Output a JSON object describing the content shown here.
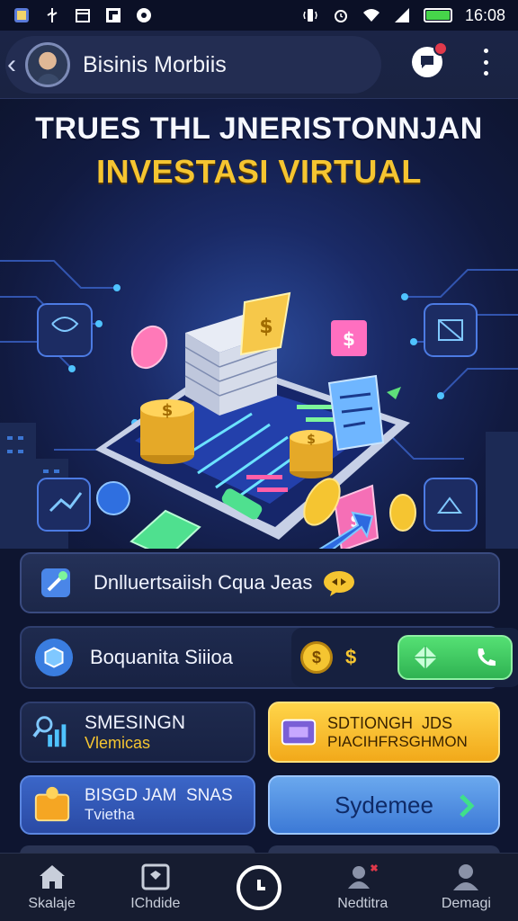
{
  "status_bar": {
    "time": "16:08",
    "battery_level": 1.0,
    "left_icons": [
      "gallery-icon",
      "usb-icon",
      "calendar-icon",
      "flipboard-icon",
      "record-icon"
    ],
    "right_icons": [
      "vibrate-icon",
      "alarm-icon",
      "wifi-icon",
      "signal-icon",
      "battery-icon"
    ]
  },
  "header": {
    "title": "Bisinis Morbiis",
    "has_notification": true
  },
  "hero": {
    "title": "TRUES THL JNERISTONNJAN",
    "subtitle": "INVESTASI VIRTUAL"
  },
  "cards": {
    "row1": {
      "label": "Dnlluertsaiish Cqua Jeas",
      "icon": "wand-icon",
      "badge_icon": "chat-bubble-icon"
    },
    "row2": {
      "label": "Boquanita Siiioa",
      "icon": "cube-icon",
      "coin_text": "$",
      "star_text": "$"
    },
    "row3_left": {
      "title": "SMESINGN",
      "subtitle": "Vlemicas",
      "icon": "chart-magnifier-icon"
    },
    "row3_right": {
      "title": "SDTIONGH  JDS",
      "subtitle": "PIACIHFRSGHMON",
      "icon": "card-icon"
    },
    "row4_left": {
      "title": "BISGD JAM  SNAS",
      "subtitle": "Tvietha",
      "icon": "wallet-icon"
    },
    "row4_right": {
      "label": "Sydemee",
      "icon": "chevron-right-icon"
    }
  },
  "bottom_nav": {
    "items": [
      {
        "label": "Skalaje",
        "icon": "home-icon"
      },
      {
        "label": "IChdide",
        "icon": "frame-icon"
      },
      {
        "label": "",
        "icon": "clock-icon"
      },
      {
        "label": "Nedtitra",
        "icon": "people-alert-icon"
      },
      {
        "label": "Demagi",
        "icon": "user-icon"
      }
    ]
  },
  "colors": {
    "accent_gold": "#f5c531",
    "accent_green": "#46d54a",
    "background": "#0e1530"
  }
}
